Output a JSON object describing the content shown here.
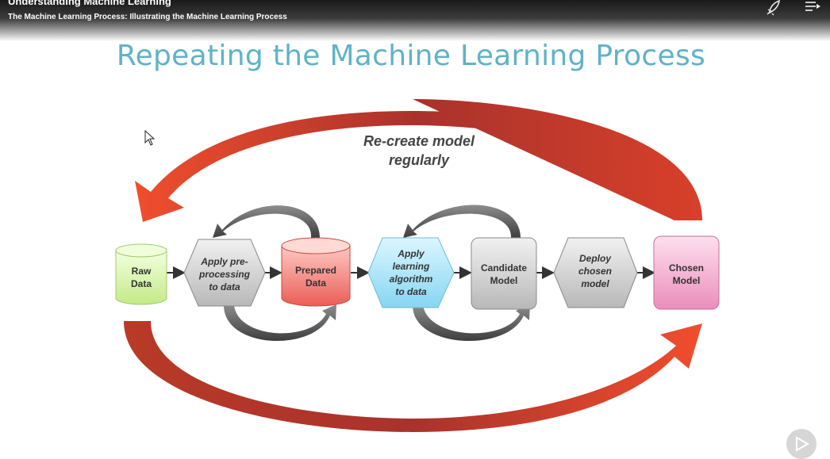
{
  "header": {
    "course_title": "Understanding Machine Learning",
    "module_title": "The Machine Learning Process: Illustrating the Machine Learning Process",
    "icons": [
      "rocket-icon",
      "transcript-menu-icon"
    ]
  },
  "slide": {
    "title": "Repeating the Machine Learning Process",
    "loop_label": [
      "Re-create model",
      "regularly"
    ],
    "nodes": {
      "raw_data": [
        "Raw",
        "Data"
      ],
      "preprocess": [
        "Apply pre-",
        "processing",
        "to data"
      ],
      "prepared_data": [
        "Prepared",
        "Data"
      ],
      "apply_algorithm": [
        "Apply",
        "learning",
        "algorithm",
        "to data"
      ],
      "candidate_model": [
        "Candidate",
        "Model"
      ],
      "deploy_model": [
        "Deploy",
        "chosen",
        "model"
      ],
      "chosen_model": [
        "Chosen",
        "Model"
      ]
    }
  },
  "colors": {
    "title": "#5fb3c6",
    "cycle_arrow": "#e0432a",
    "raw_data": "#d8f5a8",
    "prepared_data": "#f07a73",
    "apply_algorithm": "#9fe2f7",
    "candidate_model": "#cfcfcf",
    "deploy_model": "#d9d9d9",
    "chosen_model": "#f2a6c8"
  },
  "player": {
    "play_icon": "play-icon"
  }
}
